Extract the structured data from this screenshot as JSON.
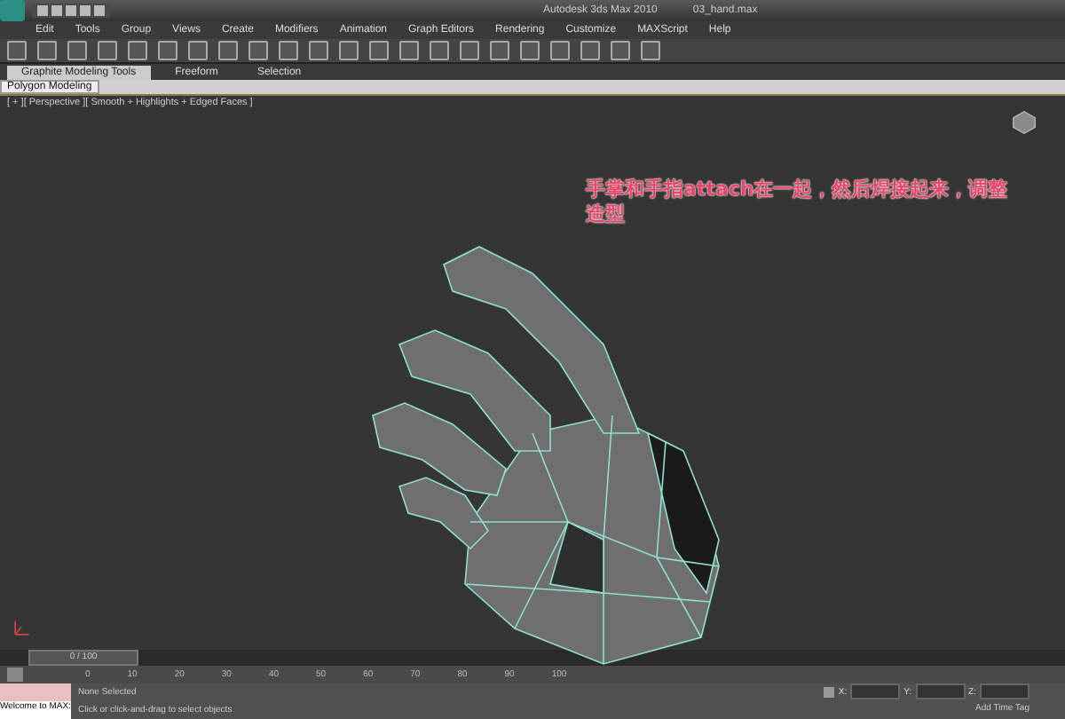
{
  "window": {
    "app_title": "Autodesk 3ds Max 2010",
    "file_name": "03_hand.max"
  },
  "menu": [
    "Edit",
    "Tools",
    "Group",
    "Views",
    "Create",
    "Modifiers",
    "Animation",
    "Graph Editors",
    "Rendering",
    "Customize",
    "MAXScript",
    "Help"
  ],
  "ribbon": {
    "tabs": [
      {
        "label": "Graphite Modeling Tools",
        "selected": true
      },
      {
        "label": "Freeform",
        "selected": false
      },
      {
        "label": "Selection",
        "selected": false
      }
    ],
    "panel": "Polygon Modeling"
  },
  "viewport": {
    "label": "[ + ][ Perspective ][ Smooth + Highlights + Edged Faces ]",
    "annotation": "手掌和手指attach在一起，然后焊接起来，调整造型"
  },
  "timeline": {
    "slider": "0 / 100",
    "level": 0,
    "ticks": [
      "0",
      "10",
      "20",
      "30",
      "40",
      "50",
      "60",
      "70",
      "80",
      "90",
      "100"
    ]
  },
  "status_bar": {
    "listener": "Welcome to MAX:",
    "selection": "None Selected",
    "prompt": "Click or click-and-drag to select objects",
    "coords": [
      "X:",
      "Y:",
      "Z:"
    ],
    "time_tag": "Add Time Tag"
  }
}
